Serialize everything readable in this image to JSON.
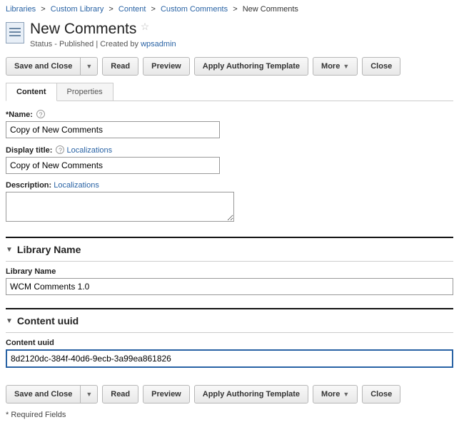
{
  "breadcrumb": {
    "libraries": "Libraries",
    "custom_library": "Custom Library",
    "content": "Content",
    "custom_comments": "Custom Comments",
    "current": "New Comments"
  },
  "header": {
    "title": "New Comments",
    "status_prefix": "Status - Published | Created by ",
    "created_by": "wpsadmin"
  },
  "toolbar": {
    "save_and_close": "Save and Close",
    "read": "Read",
    "preview": "Preview",
    "apply_template": "Apply Authoring Template",
    "more": "More",
    "close": "Close"
  },
  "tabs": {
    "content": "Content",
    "properties": "Properties"
  },
  "fields": {
    "name_label": "*Name:",
    "name_value": "Copy of New Comments",
    "display_title_label": "Display title:",
    "display_title_value": "Copy of New Comments",
    "localizations": "Localizations",
    "description_label": "Description:",
    "description_value": ""
  },
  "sections": {
    "library_name": {
      "heading": "Library Name",
      "label": "Library Name",
      "value": "WCM Comments 1.0"
    },
    "content_uuid": {
      "heading": "Content uuid",
      "label": "Content uuid",
      "value": "8d2120dc-384f-40d6-9ecb-3a99ea861826"
    }
  },
  "footer": {
    "required": "* Required Fields"
  }
}
